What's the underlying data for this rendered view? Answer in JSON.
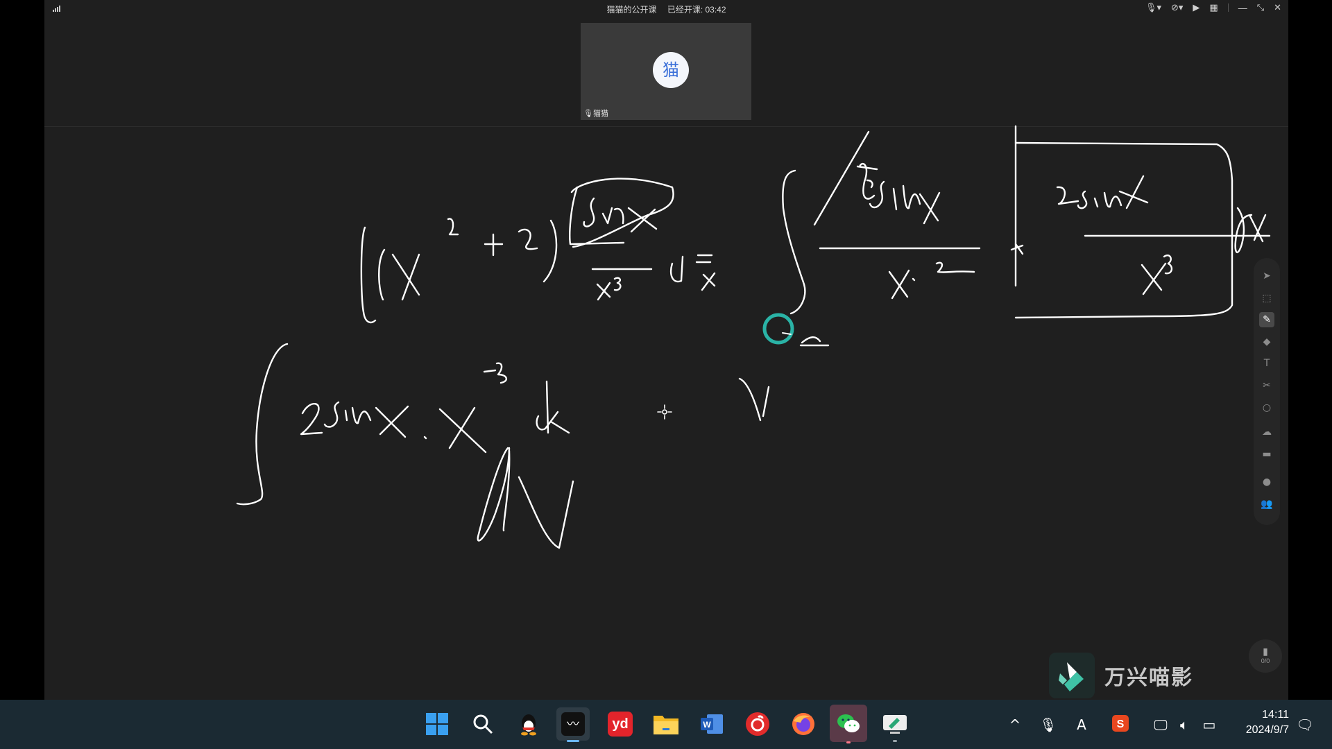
{
  "window": {
    "title": "猫猫的公开课",
    "status": "已经开课: 03:42"
  },
  "participant": {
    "avatar_char": "猫",
    "name": "猫猫"
  },
  "toolbar": {
    "tools": [
      "pointer-icon",
      "select-icon",
      "pen-icon",
      "eraser-icon",
      "text-icon",
      "scissors-icon",
      "shape-icon",
      "cloud-icon",
      "toolbox-icon",
      "chat-icon",
      "members-icon"
    ],
    "active_tool": "pen-icon"
  },
  "page_counter": "0/0",
  "watermark": {
    "text": "万兴喵影"
  },
  "taskbar": {
    "apps": [
      "windows-start-icon",
      "search-icon",
      "qq-icon",
      "board-app-icon",
      "youdao-icon",
      "file-explorer-icon",
      "word-icon",
      "netease-music-icon",
      "firefox-icon",
      "wechat-icon",
      "classroom-app-icon"
    ],
    "active_app": "wechat-icon",
    "tray_ime": "A",
    "time": "14:11",
    "date": "2024/9/7"
  },
  "colors": {
    "app_bg": "#1f1f1f",
    "ink": "#ffffff",
    "cursor_ring": "#2ab3a6",
    "taskbar_bg": "#1b2a33"
  }
}
